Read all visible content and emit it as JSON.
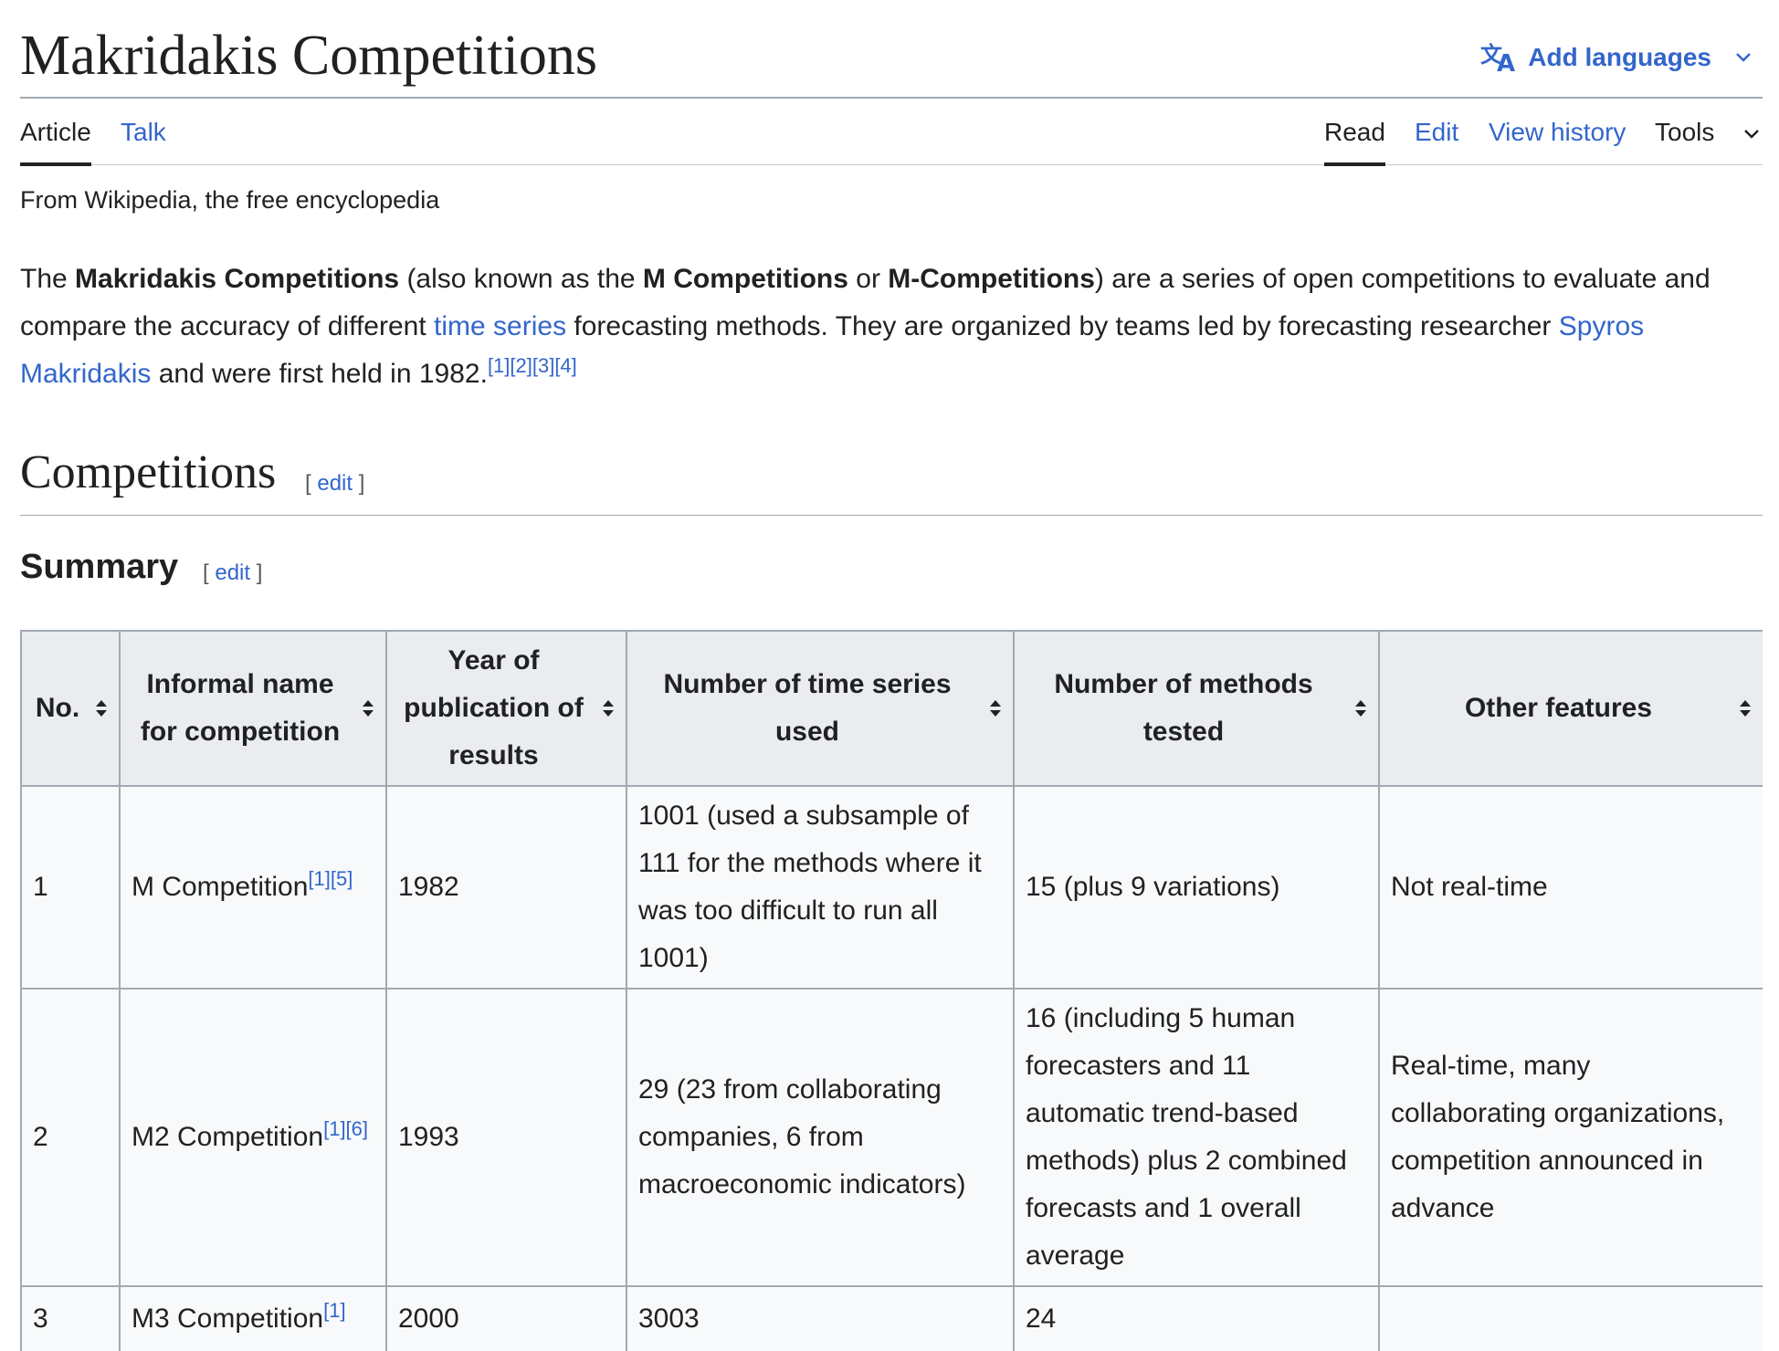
{
  "header": {
    "title": "Makridakis Competitions",
    "add_languages": "Add languages"
  },
  "tabs": {
    "article": "Article",
    "talk": "Talk",
    "read": "Read",
    "edit": "Edit",
    "view_history": "View history",
    "tools": "Tools"
  },
  "tagline": "From Wikipedia, the free encyclopedia",
  "intro": {
    "t1": "The ",
    "b1": "Makridakis Competitions",
    "t2": " (also known as the ",
    "b2": "M Competitions",
    "t3": " or ",
    "b3": "M-Competitions",
    "t4": ") are a series of open competitions to evaluate and compare the accuracy of different ",
    "link1": "time series",
    "t5": " forecasting methods. They are organized by teams led by forecasting researcher ",
    "link2": "Spyros Makridakis",
    "t6": " and were first held in 1982.",
    "refs": "[1][2][3][4]"
  },
  "sections": {
    "competitions": "Competitions",
    "summary": "Summary",
    "edit_label": "edit",
    "bracket_open": "[ ",
    "bracket_close": " ]"
  },
  "table": {
    "headers": [
      "No.",
      "Informal name for competition",
      "Year of publication of results",
      "Number of time series used",
      "Number of methods tested",
      "Other features"
    ],
    "rows": [
      {
        "no": "1",
        "name": "M Competition",
        "name_refs": "[1][5]",
        "year": "1982",
        "series": "1001 (used a subsample of 111 for the methods where it was too difficult to run all 1001)",
        "methods": "15 (plus 9 variations)",
        "features": "Not real-time"
      },
      {
        "no": "2",
        "name": "M2 Competition",
        "name_refs": "[1][6]",
        "year": "1993",
        "series": "29 (23 from collaborating companies, 6 from macroeconomic indicators)",
        "methods": "16 (including 5 human forecasters and 11 automatic trend-based methods) plus 2 combined forecasts and 1 overall average",
        "features": "Real-time, many collaborating organizations, competition announced in advance"
      },
      {
        "no": "3",
        "name": "M3 Competition",
        "name_refs": "[1]",
        "year": "2000",
        "series": "3003",
        "methods": "24",
        "features": ""
      }
    ]
  },
  "colors": {
    "link": "#3366cc",
    "text": "#202122",
    "header_bg": "#eaecf0",
    "cell_bg": "#f8f9fa",
    "border": "#a2a9b1"
  }
}
